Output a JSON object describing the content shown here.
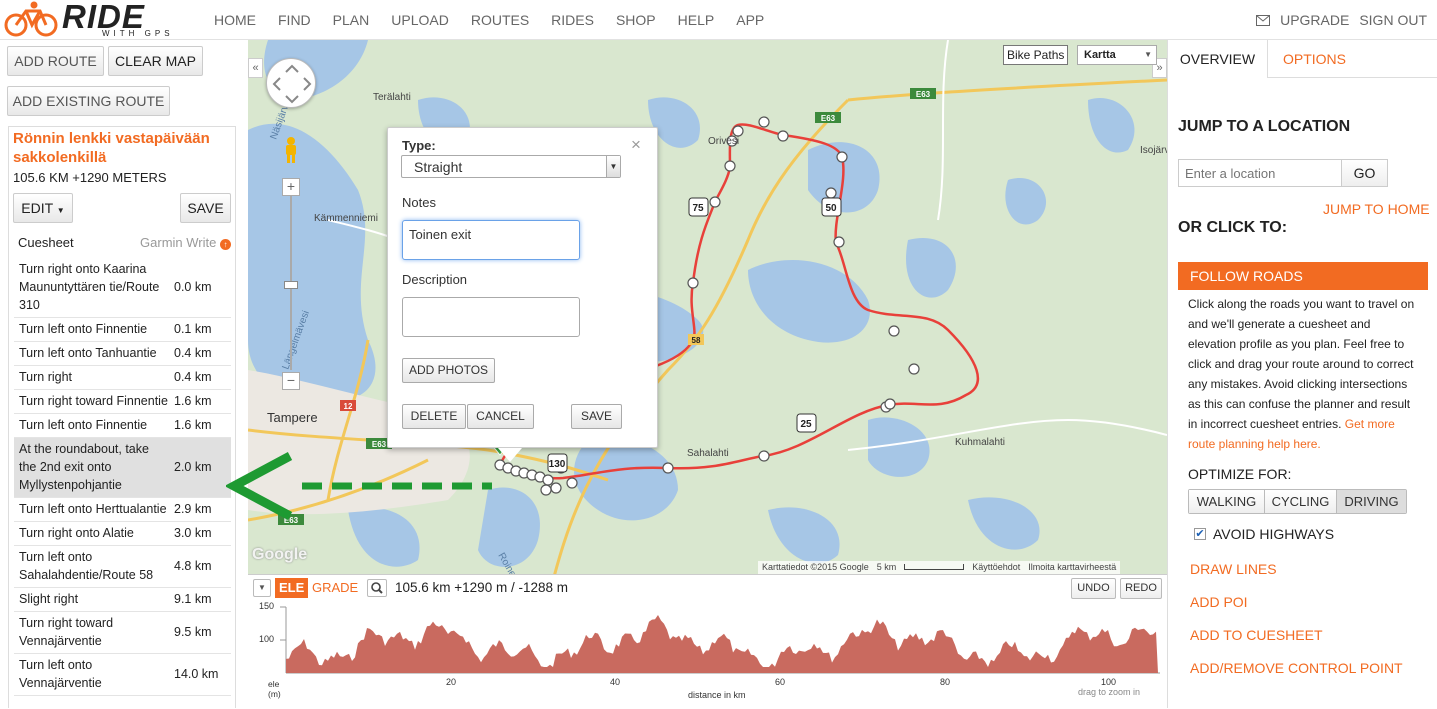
{
  "app": {
    "logo_word": "RIDE",
    "logo_sub": "WITH GPS"
  },
  "topnav": {
    "items": [
      "HOME",
      "FIND",
      "PLAN",
      "UPLOAD",
      "ROUTES",
      "RIDES",
      "SHOP",
      "HELP",
      "APP"
    ],
    "upgrade": "UPGRADE",
    "signout": "SIGN OUT"
  },
  "left": {
    "add_route": "ADD ROUTE",
    "clear_map": "CLEAR MAP",
    "add_existing": "ADD EXISTING ROUTE",
    "route_title": "Rönnin lenkki vastapäivään sakkolenkillä",
    "route_stats": "105.6 KM +1290 METERS",
    "edit": "EDIT",
    "save": "SAVE",
    "cuesheet": "Cuesheet",
    "garmin": "Garmin Write",
    "cues": [
      {
        "text": "Turn right onto Kaarina Maununtyttären tie/Route 310",
        "dist": "0.0 km"
      },
      {
        "text": "Turn left onto Finnentie",
        "dist": "0.1 km"
      },
      {
        "text": "Turn left onto Tanhuantie",
        "dist": "0.4 km"
      },
      {
        "text": "Turn right",
        "dist": "0.4 km"
      },
      {
        "text": "Turn right toward Finnentie",
        "dist": "1.6 km"
      },
      {
        "text": "Turn left onto Finnentie",
        "dist": "1.6 km"
      },
      {
        "text": "At the roundabout, take the 2nd exit onto Myllystenpohjantie",
        "dist": "2.0 km"
      },
      {
        "text": "Turn left onto Herttualantie",
        "dist": "2.9 km"
      },
      {
        "text": "Turn right onto Alatie",
        "dist": "3.0 km"
      },
      {
        "text": "Turn left onto Sahalahdentie/Route 58",
        "dist": "4.8 km"
      },
      {
        "text": "Slight right",
        "dist": "9.1 km"
      },
      {
        "text": "Turn right toward Vennajärventie",
        "dist": "9.5 km"
      },
      {
        "text": "Turn left onto Vennajärventie",
        "dist": "14.0 km"
      }
    ],
    "selected_cue": 6
  },
  "map": {
    "bike_paths": "Bike Paths",
    "map_type": "Kartta",
    "place_labels": [
      "Terälahti",
      "Orivesi",
      "Kämmenniemi",
      "Tampere",
      "Sahalahti",
      "Kuhmalahti",
      "Isojärvi",
      "Näsijärvi",
      "Längelmävesi",
      "Roine"
    ],
    "road_labels": [
      "E63",
      "E63",
      "E63",
      "E63",
      "12",
      "58",
      "75",
      "50",
      "25",
      "130"
    ],
    "attribution": "Karttatiedot ©2015 Google",
    "scale": "5 km",
    "terms": "Käyttöehdot",
    "report": "Ilmoita karttavirheestä",
    "google": "Google"
  },
  "modal": {
    "type_label": "Type:",
    "type_value": "Straight",
    "notes_label": "Notes",
    "notes_value": "Toinen exit",
    "description_label": "Description",
    "add_photos": "ADD PHOTOS",
    "delete": "DELETE",
    "cancel": "CANCEL",
    "save": "SAVE"
  },
  "elevation": {
    "ele": "ELE",
    "grade": "GRADE",
    "summary": "105.6 km +1290 m / -1288 m",
    "undo": "UNDO",
    "redo": "REDO",
    "y_ticks": [
      "150",
      "100"
    ],
    "x_ticks": [
      "20",
      "40",
      "60",
      "80",
      "100"
    ],
    "y_label": "ele (m)",
    "x_label": "distance in km",
    "zoom_hint": "drag to zoom in",
    "chart_color": "#c96a5f"
  },
  "right": {
    "tab_overview": "OVERVIEW",
    "tab_options": "OPTIONS",
    "jump_heading": "JUMP TO A LOCATION",
    "location_placeholder": "Enter a location",
    "go": "GO",
    "jump_home": "JUMP TO HOME",
    "or_click": "OR CLICK TO:",
    "follow_roads": "FOLLOW ROADS",
    "follow_desc": "Click along the roads you want to travel on and we'll generate a cuesheet and elevation profile as you plan. Feel free to click and drag your route around to correct any mistakes. Avoid clicking intersections as this can confuse the planner and result in incorrect cuesheet entries.",
    "follow_link": "Get more route planning help here.",
    "optimize": "OPTIMIZE FOR:",
    "opt_walking": "WALKING",
    "opt_cycling": "CYCLING",
    "opt_driving": "DRIVING",
    "avoid_highways": "AVOID HIGHWAYS",
    "draw_lines": "DRAW LINES",
    "add_poi": "ADD POI",
    "add_cuesheet": "ADD TO CUESHEET",
    "add_control": "ADD/REMOVE CONTROL POINT"
  },
  "colors": {
    "accent": "#f26b22",
    "route": "#e8403a",
    "water": "#a6c6e6",
    "land": "#d9e7cf"
  }
}
